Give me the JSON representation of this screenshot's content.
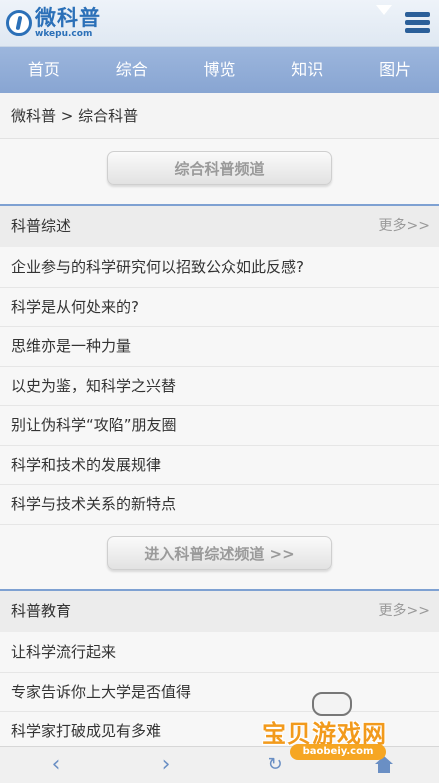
{
  "header": {
    "logo_cn": "微科普",
    "logo_en": "wkepu.com"
  },
  "nav": {
    "items": [
      "首页",
      "综合",
      "博览",
      "知识",
      "图片"
    ]
  },
  "breadcrumb": "微科普 > 综合科普",
  "channel_button": "综合科普频道",
  "sections": [
    {
      "title": "科普综述",
      "more": "更多>>",
      "items": [
        "企业参与的科学研究何以招致公众如此反感?",
        "科学是从何处来的?",
        "思维亦是一种力量",
        "以史为鉴，知科学之兴替",
        "别让伪科学“攻陷”朋友圈",
        "科学和技术的发展规律",
        "科学与技术关系的新特点"
      ],
      "enter_button": "进入科普综述频道 >>"
    },
    {
      "title": "科普教育",
      "more": "更多>>",
      "items": [
        "让科学流行起来",
        "专家告诉你上大学是否值得",
        "科学家打破成见有多难"
      ]
    }
  ],
  "bottombar": {
    "icons": [
      "back-icon",
      "forward-icon",
      "refresh-icon",
      "home-icon"
    ]
  },
  "watermark": {
    "cn": "宝贝游戏网",
    "en": "baobeiy.com"
  },
  "colors": {
    "nav_bg": "#8fabd6",
    "accent": "#2b70b8",
    "section_border": "#7ea1d2"
  }
}
